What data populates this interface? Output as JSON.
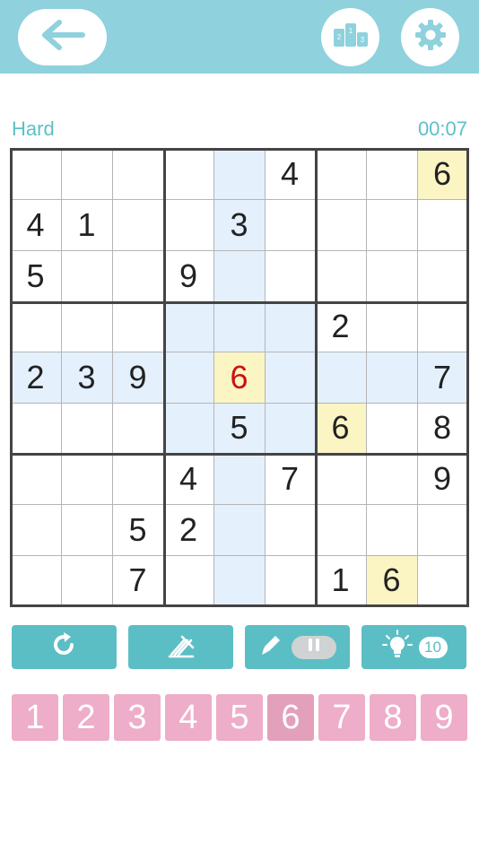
{
  "header": {
    "back_icon": "arrow-left-icon",
    "ranking_icon": "podium-icon",
    "ranking_digits": [
      "2",
      "1",
      "3"
    ],
    "settings_icon": "gear-icon"
  },
  "game": {
    "difficulty": "Hard",
    "timer": "00:07",
    "selected_row": 4,
    "selected_col": 4,
    "grid": [
      [
        "",
        "",
        "",
        "",
        "",
        "4",
        "",
        "",
        "6"
      ],
      [
        "4",
        "1",
        "",
        "",
        "3",
        "",
        "",
        "",
        ""
      ],
      [
        "5",
        "",
        "",
        "9",
        "",
        "",
        "",
        "",
        ""
      ],
      [
        "",
        "",
        "",
        "",
        "",
        "",
        "2",
        "",
        ""
      ],
      [
        "2",
        "3",
        "9",
        "",
        "6",
        "",
        "",
        "",
        "7"
      ],
      [
        "",
        "",
        "",
        "",
        "5",
        "",
        "6",
        "",
        "8"
      ],
      [
        "",
        "",
        "",
        "4",
        "",
        "7",
        "",
        "",
        "9"
      ],
      [
        "",
        "",
        "5",
        "2",
        "",
        "",
        "",
        "",
        ""
      ],
      [
        "",
        "",
        "7",
        "",
        "",
        "",
        "1",
        "6",
        ""
      ]
    ],
    "error_cells": [
      [
        4,
        4
      ]
    ]
  },
  "toolbar": {
    "undo_icon": "redo-icon",
    "erase_icon": "eraser-icon",
    "notes_icon": "pencil-icon",
    "notes_toggle_icon": "pause-icon",
    "hint_icon": "lightbulb-icon",
    "hint_count": "10"
  },
  "numpad": {
    "keys": [
      "1",
      "2",
      "3",
      "4",
      "5",
      "6",
      "7",
      "8",
      "9"
    ],
    "active": "6"
  },
  "colors": {
    "header_bg": "#8fd1dd",
    "accent": "#5cc0c7",
    "highlight": "#e4f0fc",
    "match": "#fbf5c4",
    "error": "#cc1212",
    "numpad_bg": "#eeadc8"
  }
}
